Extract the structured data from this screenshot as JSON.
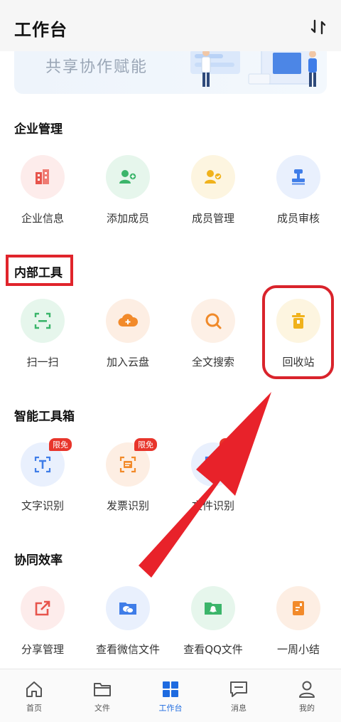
{
  "header": {
    "title": "工作台",
    "sort_icon": "sort-icon"
  },
  "banner": {
    "text": "共享协作赋能"
  },
  "sections": {
    "enterprise": {
      "title": "企业管理",
      "items": [
        {
          "label": "企业信息",
          "icon": "building-icon",
          "color": "#e7544c",
          "bg": "#fdeceb"
        },
        {
          "label": "添加成员",
          "icon": "add-user-icon",
          "color": "#3bb56a",
          "bg": "#e6f6ec"
        },
        {
          "label": "成员管理",
          "icon": "manage-users-icon",
          "color": "#f0b21c",
          "bg": "#fdf5e0"
        },
        {
          "label": "成员审核",
          "icon": "stamp-icon",
          "color": "#3f7de8",
          "bg": "#e9f0fd"
        }
      ]
    },
    "internal": {
      "title": "内部工具",
      "items": [
        {
          "label": "扫一扫",
          "icon": "scan-icon",
          "color": "#3bb56a",
          "bg": "#e6f6ec"
        },
        {
          "label": "加入云盘",
          "icon": "cloud-add-icon",
          "color": "#f28a2a",
          "bg": "#fdeee3"
        },
        {
          "label": "全文搜索",
          "icon": "search-icon",
          "color": "#f08a2a",
          "bg": "#fdf0e6"
        },
        {
          "label": "回收站",
          "icon": "trash-icon",
          "color": "#f0b21c",
          "bg": "#fdf5e0"
        }
      ]
    },
    "smart": {
      "title": "智能工具箱",
      "badge": "限免",
      "items": [
        {
          "label": "文字识别",
          "icon": "text-recognition-icon",
          "color": "#3f7de8",
          "bg": "#e9f0fd",
          "badge": true
        },
        {
          "label": "发票识别",
          "icon": "invoice-recognition-icon",
          "color": "#f28a2a",
          "bg": "#fdeee3",
          "badge": true
        },
        {
          "label": "文件识别",
          "icon": "file-recognition-icon",
          "color": "#3f7de8",
          "bg": "#e9f0fd",
          "badge": true
        }
      ]
    },
    "collab": {
      "title": "协同效率",
      "items": [
        {
          "label": "分享管理",
          "icon": "share-icon",
          "color": "#e7544c",
          "bg": "#fdeceb"
        },
        {
          "label": "查看微信文件",
          "icon": "wechat-folder-icon",
          "color": "#3f7de8",
          "bg": "#e9f0fd"
        },
        {
          "label": "查看QQ文件",
          "icon": "qq-folder-icon",
          "color": "#3bb56a",
          "bg": "#e6f6ec"
        },
        {
          "label": "一周小结",
          "icon": "weekly-summary-icon",
          "color": "#f28a2a",
          "bg": "#fdeee3"
        }
      ]
    }
  },
  "tabbar": [
    {
      "label": "首页",
      "icon": "home-icon"
    },
    {
      "label": "文件",
      "icon": "folder-icon"
    },
    {
      "label": "工作台",
      "icon": "workbench-icon",
      "active": true
    },
    {
      "label": "消息",
      "icon": "message-icon"
    },
    {
      "label": "我的",
      "icon": "profile-icon"
    }
  ],
  "colors": {
    "accent": "#1e6be0",
    "annotation": "#e0242b"
  }
}
